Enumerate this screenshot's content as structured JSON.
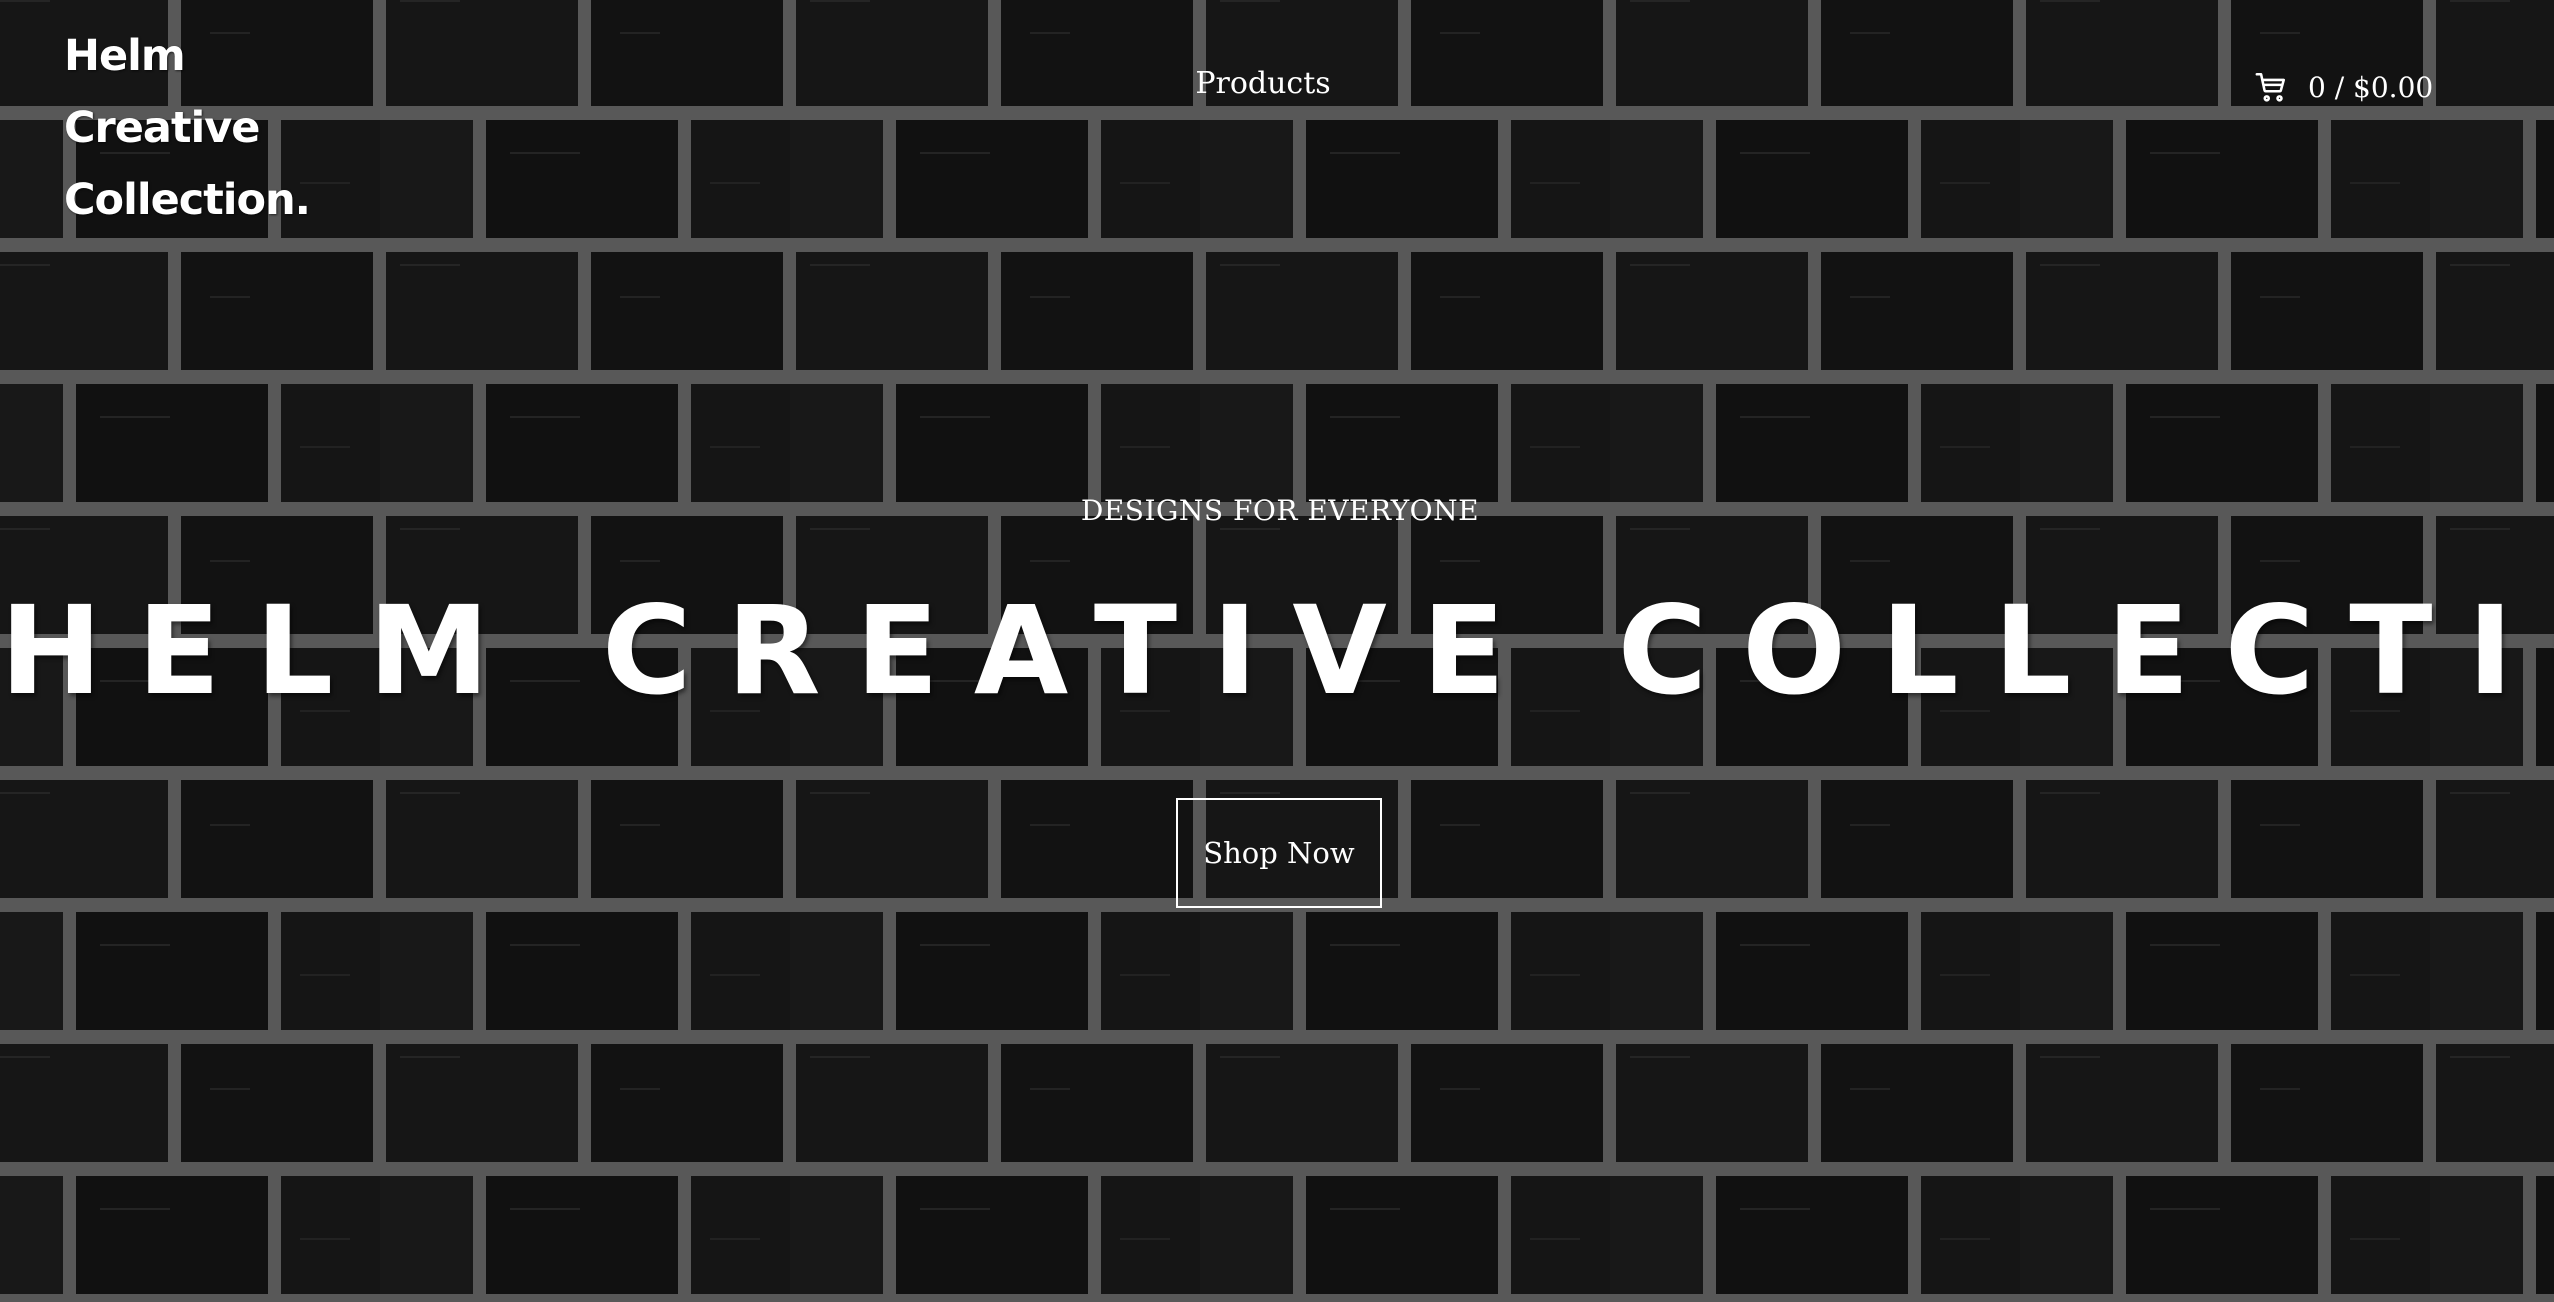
{
  "header": {
    "logo_line1": "Helm Creative",
    "logo_line2": "Collection.",
    "nav_products": "Products",
    "cart_summary": "0 / $0.00",
    "cart_icon": "shopping-cart-icon"
  },
  "hero": {
    "eyebrow": "DESIGNS FOR EVERYONE",
    "title": "HELM CREATIVE COLLECTION",
    "cta_label": "Shop Now",
    "background": "black-brick-wall"
  },
  "colors": {
    "text": "#ffffff",
    "brick": "#1a1a1a",
    "mortar": "#6e6e6e",
    "background": "#121212"
  }
}
